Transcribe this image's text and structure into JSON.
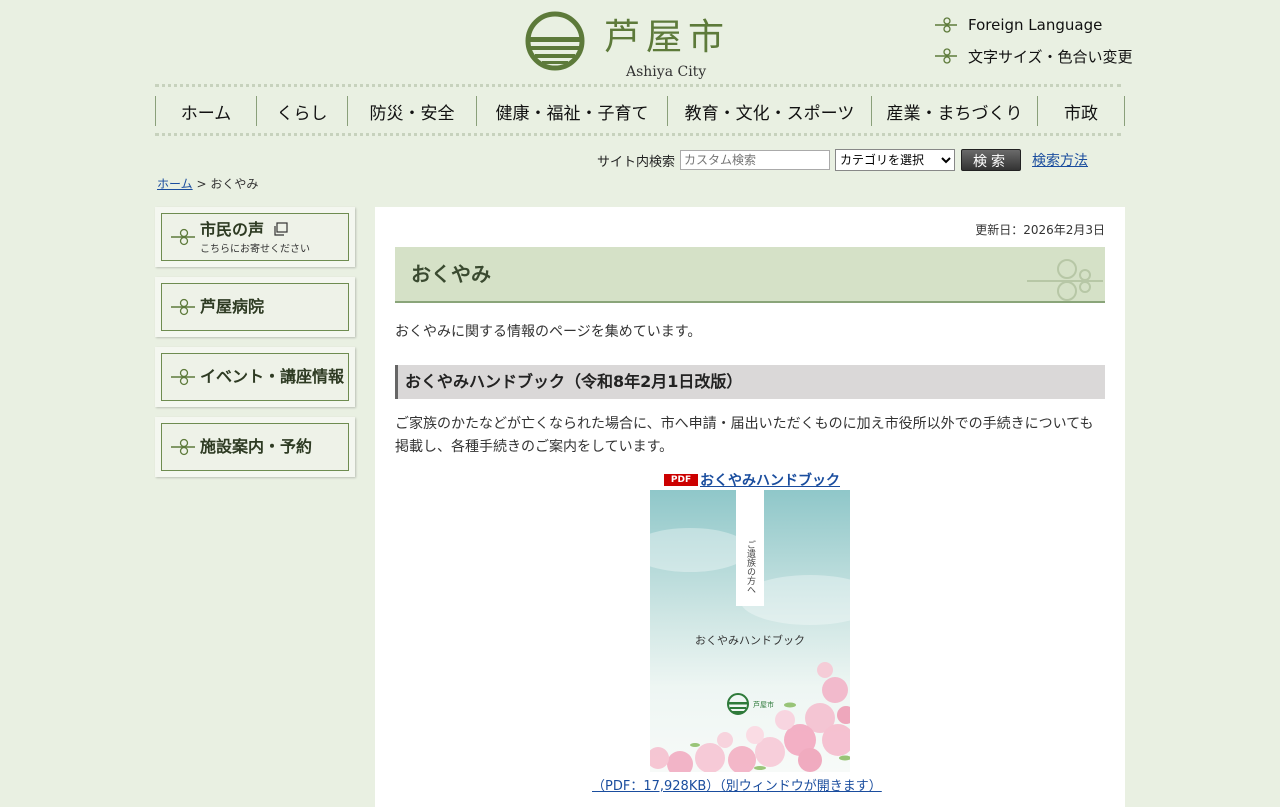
{
  "header": {
    "logo_jp": "芦屋市",
    "logo_en": "Ashiya City",
    "foreign_language": "Foreign Language",
    "text_size_color": "文字サイズ・色合い変更"
  },
  "gnav": [
    {
      "label": "ホーム"
    },
    {
      "label": "くらし"
    },
    {
      "label": "防災・安全"
    },
    {
      "label": "健康・福祉・子育て"
    },
    {
      "label": "教育・文化・スポーツ"
    },
    {
      "label": "産業・まちづくり"
    },
    {
      "label": "市政"
    }
  ],
  "search": {
    "label": "サイト内検索",
    "placeholder": "カスタム検索",
    "category_selected": "カテゴリを選択",
    "button": "検索",
    "howto": "検索方法"
  },
  "breadcrumb": {
    "home": "ホーム",
    "separator": " > ",
    "current": "おくやみ"
  },
  "sidebar": {
    "banners": [
      {
        "label": "市民の声",
        "sub": "こちらにお寄せください"
      },
      {
        "label": "芦屋病院"
      },
      {
        "label": "イベント・講座情報"
      },
      {
        "label": "施設案内・予約"
      }
    ]
  },
  "main": {
    "updated": "更新日：2026年2月3日",
    "title": "おくやみ",
    "intro": "おくやみに関する情報のページを集めています。",
    "section_heading": "おくやみハンドブック（令和8年2月1日改版）",
    "section_text": "ご家族のかたなどが亡くなられた場合に、市へ申請・届出いただくものに加え市役所以外での手続きについても掲載し、各種手続きのご案内をしています。",
    "pdf_badge": "PDF",
    "pdf_link": "おくやみハンドブック",
    "pdf_size": "（PDF：17,928KB）（別ウィンドウが開きます）",
    "cover": {
      "vertical": "ご遺族の方へ",
      "title": "おくやみハンドブック",
      "city": "芦屋市"
    }
  },
  "colors": {
    "background": "#e9f0e2",
    "accent_green": "#5d7a3a",
    "link": "#1a4d9e",
    "title_band": "#d5e1c7"
  }
}
